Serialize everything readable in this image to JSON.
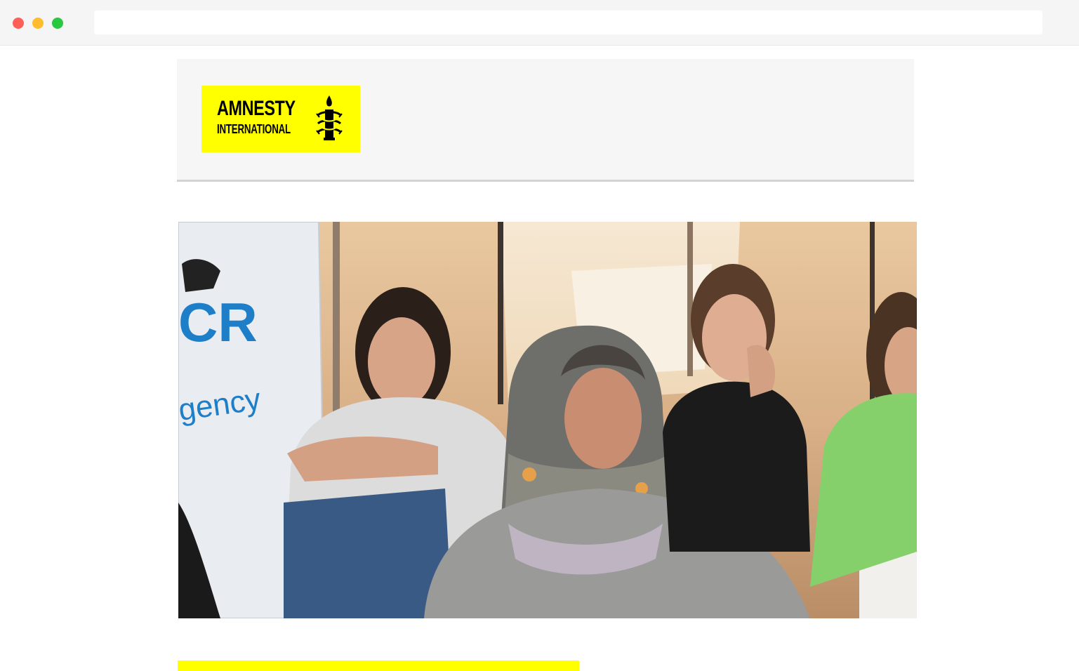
{
  "browser": {
    "address_bar_value": "",
    "controls": [
      "close",
      "minimize",
      "maximize"
    ]
  },
  "header": {
    "logo": {
      "line1": "AMNESTY",
      "line2": "INTERNATIONAL",
      "icon": "candle-barbed-wire-icon",
      "background_color": "#ffff00"
    }
  },
  "hero_image": {
    "description_icon": "photo",
    "tent_sign_fragments": [
      "CR",
      "gency"
    ]
  },
  "colors": {
    "brand_yellow": "#ffff00",
    "header_bg": "#f6f6f6",
    "divider": "#d3d3d3"
  }
}
